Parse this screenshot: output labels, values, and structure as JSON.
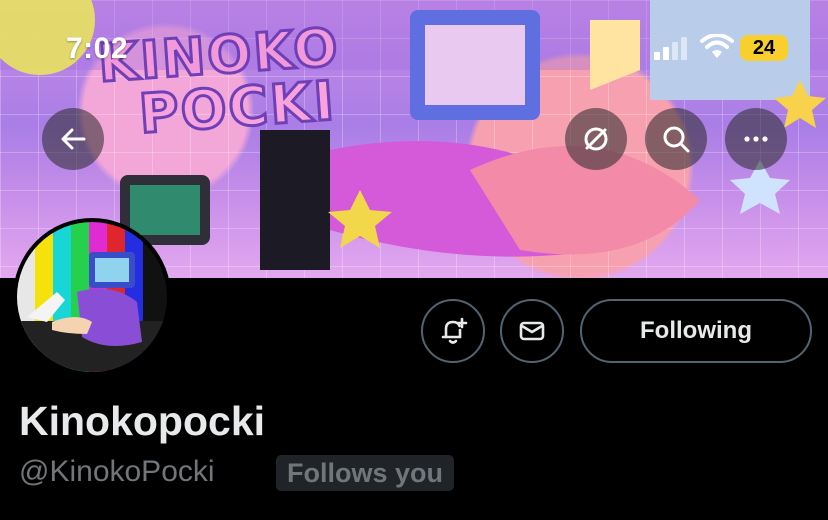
{
  "status_bar": {
    "time": "7:02",
    "battery": "24"
  },
  "banner": {
    "art_title_line1": "KINOKO",
    "art_title_line2": "POCKI"
  },
  "nav": {
    "back_icon": "back-arrow-icon",
    "retweet_icon": "circle-slash-icon",
    "search_icon": "search-icon",
    "more_icon": "more-icon"
  },
  "profile": {
    "display_name": "Kinokopocki",
    "handle": "@KinokoPocki",
    "follows_you_label": "Follows you",
    "following_label": "Following"
  },
  "colors": {
    "background": "#000000",
    "text": "#e7e9ea",
    "secondary": "#71767b",
    "border": "#536471",
    "badge_bg": "#202327",
    "battery": "#f8cf2c"
  }
}
